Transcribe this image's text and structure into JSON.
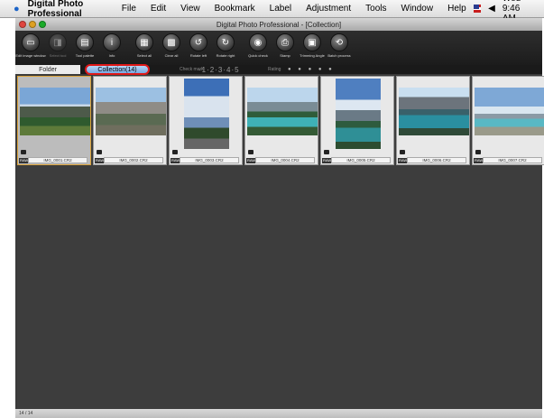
{
  "menubar": {
    "app_name": "Digital Photo Professional",
    "items": [
      "File",
      "Edit",
      "View",
      "Bookmark",
      "Label",
      "Adjustment",
      "Tools",
      "Window",
      "Help"
    ],
    "clock": "Wed 9:46 AM"
  },
  "window": {
    "title": "Digital Photo Professional - [Collection]"
  },
  "toolbar": {
    "tools": [
      {
        "label": "Edit image window",
        "icon": "edit-image-icon",
        "glyph": "▭",
        "enabled": true
      },
      {
        "label": "Select tool",
        "icon": "select-tool-icon",
        "glyph": "◨",
        "enabled": false
      },
      {
        "label": "Tool palette",
        "icon": "tool-palette-icon",
        "glyph": "▤",
        "enabled": true
      },
      {
        "label": "Info",
        "icon": "info-icon",
        "glyph": "i",
        "enabled": true
      },
      {
        "label": "Select all",
        "icon": "select-all-icon",
        "glyph": "▦",
        "enabled": true
      },
      {
        "label": "Clear all",
        "icon": "clear-all-icon",
        "glyph": "▩",
        "enabled": true
      },
      {
        "label": "Rotate left",
        "icon": "rotate-left-icon",
        "glyph": "↺",
        "enabled": true
      },
      {
        "label": "Rotate right",
        "icon": "rotate-right-icon",
        "glyph": "↻",
        "enabled": true
      },
      {
        "label": "Quick check",
        "icon": "quick-check-icon",
        "glyph": "◉",
        "enabled": true
      },
      {
        "label": "Stamp",
        "icon": "stamp-icon",
        "glyph": "⎙",
        "enabled": true
      },
      {
        "label": "Trimming Angle",
        "icon": "trimming-icon",
        "glyph": "▣",
        "enabled": true
      },
      {
        "label": "Batch process",
        "icon": "batch-process-icon",
        "glyph": "⟲",
        "enabled": true
      }
    ]
  },
  "tabs": {
    "folder": "Folder",
    "collection": "Collection(14)",
    "check_mark_label": "Check mark",
    "check_marks": "·1·2·3·4·5",
    "rating_label": "Rating",
    "rating_stars": "● ● ● ● ●"
  },
  "thumbnails": [
    {
      "name": "IMG_0001.CR2",
      "badge": "RAW",
      "selected": true
    },
    {
      "name": "IMG_0002.CR2",
      "badge": "RAW",
      "selected": false
    },
    {
      "name": "IMG_0003.CR2",
      "badge": "RAW",
      "selected": false
    },
    {
      "name": "IMG_0004.CR2",
      "badge": "RAW",
      "selected": false
    },
    {
      "name": "IMG_0005.CR2",
      "badge": "RAW",
      "selected": false
    },
    {
      "name": "IMG_0006.CR2",
      "badge": "RAW",
      "selected": false
    },
    {
      "name": "IMG_0007.CR2",
      "badge": "RAW",
      "selected": false
    }
  ],
  "statusbar": {
    "left": "14 / 14",
    "middle1": "",
    "middle2": "",
    "right": ""
  },
  "colors": {
    "selection_border": "#e01818",
    "tab_highlight": "#78a9e2"
  }
}
